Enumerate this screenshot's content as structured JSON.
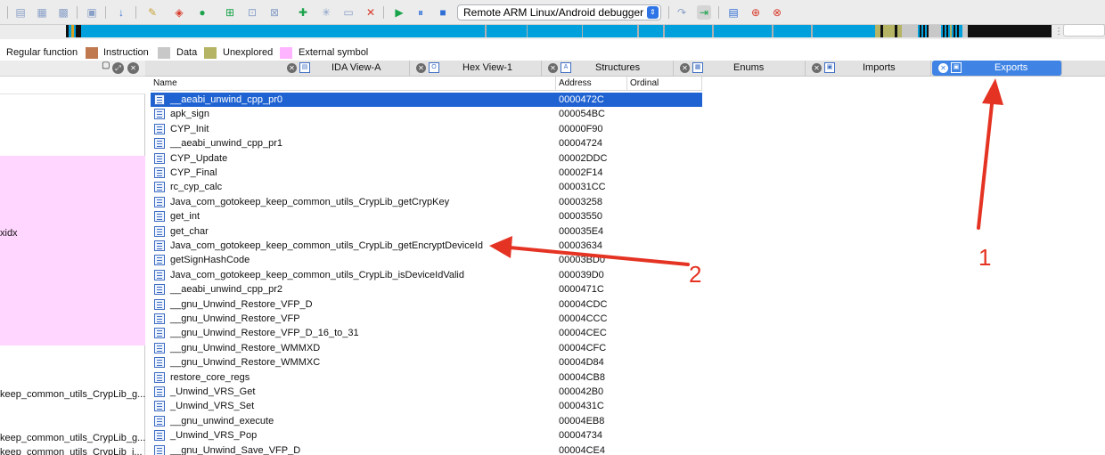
{
  "colors": {
    "toolbar_bg": "#ececec",
    "nav_blue": "#00a0dc",
    "selected_row": "#1f63d2",
    "active_tab": "#3f84e5",
    "annotation_red": "#e53323"
  },
  "toolbar": {
    "debugger_select_value": "Remote ARM Linux/Android debugger",
    "icons": [
      "list-icon",
      "jump-icon",
      "search-icon",
      "down-arrow-icon",
      "paint-icon",
      "flag-icon",
      "green-circle-icon",
      "add-icon",
      "export-icon",
      "hex-icon",
      "add-green-icon",
      "star-icon",
      "image-icon",
      "close-x-icon",
      "play-icon",
      "pause-icon",
      "stop-icon",
      "step-icon",
      "run-to-icon",
      "breakpoint-list-icon",
      "add-breakpoint-icon",
      "delete-breakpoint-icon"
    ]
  },
  "legend": {
    "items": [
      {
        "label": "Regular function",
        "color": ""
      },
      {
        "label": "Instruction",
        "color": "#c0784f"
      },
      {
        "label": "Data",
        "color": "#c8c8c8"
      },
      {
        "label": "Unexplored",
        "color": "#b4b464"
      },
      {
        "label": "External symbol",
        "color": "#ffb4ff"
      }
    ]
  },
  "left_panel": {
    "lines": [
      "xidx",
      "keep_common_utils_CrypLib_g...",
      "keep_common_utils_CrypLib_g...",
      "keep_common_utils_CrypLib_i..."
    ]
  },
  "tabs": [
    {
      "label": "IDA View-A",
      "icon": "ida-view-icon",
      "active": false
    },
    {
      "label": "Hex View-1",
      "icon": "hex-view-icon",
      "active": false
    },
    {
      "label": "Structures",
      "icon": "structures-icon",
      "active": false
    },
    {
      "label": "Enums",
      "icon": "enums-icon",
      "active": false
    },
    {
      "label": "Imports",
      "icon": "imports-icon",
      "active": false
    },
    {
      "label": "Exports",
      "icon": "exports-icon",
      "active": true
    }
  ],
  "exports": {
    "columns": [
      "Name",
      "Address",
      "Ordinal"
    ],
    "rows": [
      {
        "name": "__aeabi_unwind_cpp_pr0",
        "address": "0000472C"
      },
      {
        "name": "apk_sign",
        "address": "000054BC"
      },
      {
        "name": "CYP_Init",
        "address": "00000F90"
      },
      {
        "name": "__aeabi_unwind_cpp_pr1",
        "address": "00004724"
      },
      {
        "name": "CYP_Update",
        "address": "00002DDC"
      },
      {
        "name": "CYP_Final",
        "address": "00002F14"
      },
      {
        "name": "rc_cyp_calc",
        "address": "000031CC"
      },
      {
        "name": "Java_com_gotokeep_keep_common_utils_CrypLib_getCrypKey",
        "address": "00003258"
      },
      {
        "name": "get_int",
        "address": "00003550"
      },
      {
        "name": "get_char",
        "address": "000035E4"
      },
      {
        "name": "Java_com_gotokeep_keep_common_utils_CrypLib_getEncryptDeviceId",
        "address": "00003634"
      },
      {
        "name": "getSignHashCode",
        "address": "00003BD0"
      },
      {
        "name": "Java_com_gotokeep_keep_common_utils_CrypLib_isDeviceIdValid",
        "address": "000039D0"
      },
      {
        "name": "__aeabi_unwind_cpp_pr2",
        "address": "0000471C"
      },
      {
        "name": "__gnu_Unwind_Restore_VFP_D",
        "address": "00004CDC"
      },
      {
        "name": "__gnu_Unwind_Restore_VFP",
        "address": "00004CCC"
      },
      {
        "name": "__gnu_Unwind_Restore_VFP_D_16_to_31",
        "address": "00004CEC"
      },
      {
        "name": "__gnu_Unwind_Restore_WMMXD",
        "address": "00004CFC"
      },
      {
        "name": "__gnu_Unwind_Restore_WMMXC",
        "address": "00004D84"
      },
      {
        "name": "restore_core_regs",
        "address": "00004CB8"
      },
      {
        "name": "_Unwind_VRS_Get",
        "address": "000042B0"
      },
      {
        "name": "_Unwind_VRS_Set",
        "address": "0000431C"
      },
      {
        "name": "__gnu_unwind_execute",
        "address": "00004EB8"
      },
      {
        "name": "_Unwind_VRS_Pop",
        "address": "00004734"
      },
      {
        "name": "__gnu_Unwind_Save_VFP_D",
        "address": "00004CE4"
      }
    ]
  },
  "annotations": {
    "label_1": "1",
    "label_2": "2"
  }
}
